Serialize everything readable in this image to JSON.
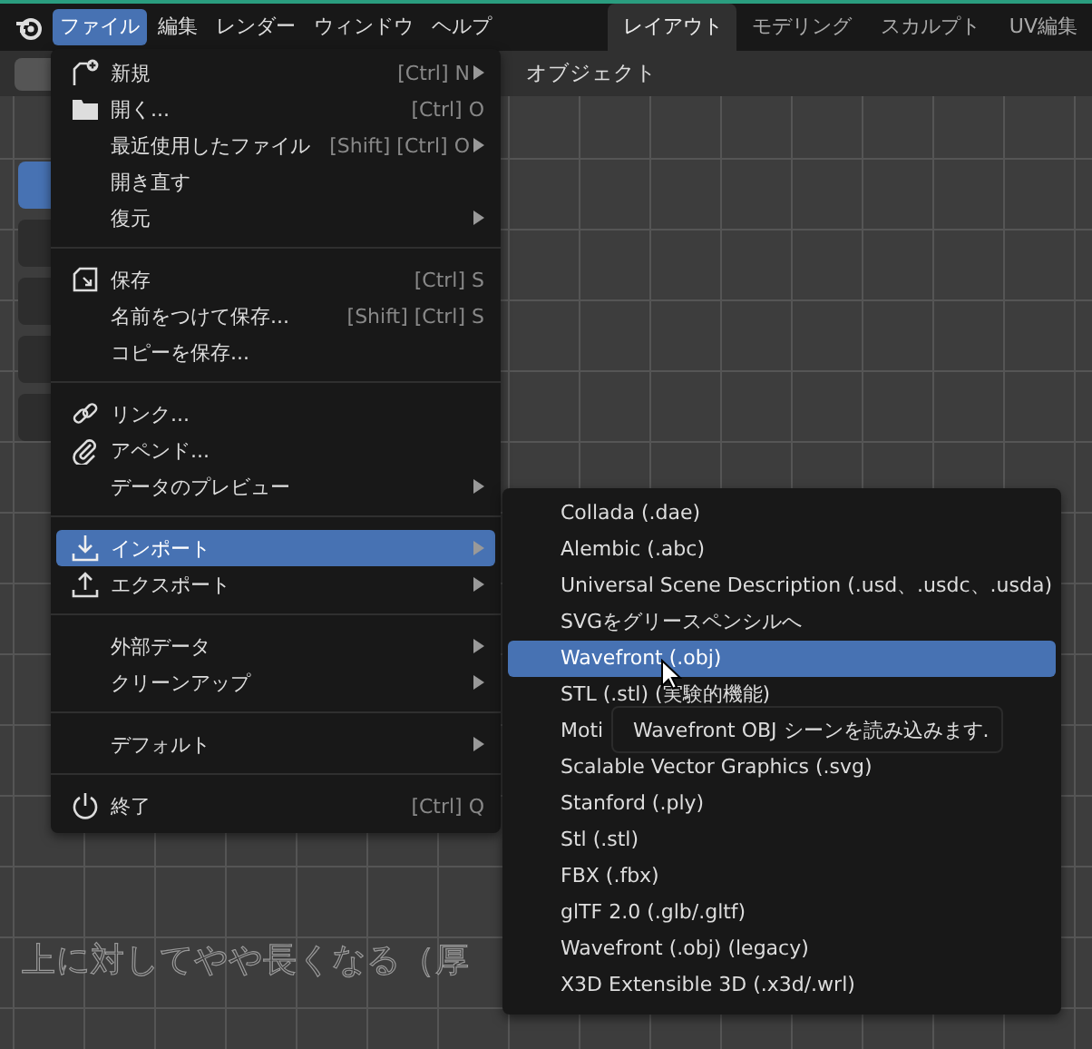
{
  "topbar": {
    "menus": [
      {
        "label": "ファイル",
        "selected": true
      },
      {
        "label": "編集",
        "selected": false
      },
      {
        "label": "レンダー",
        "selected": false
      },
      {
        "label": "ウィンドウ",
        "selected": false
      },
      {
        "label": "ヘルプ",
        "selected": false
      }
    ],
    "workspaces": [
      {
        "label": "レイアウト",
        "selected": true
      },
      {
        "label": "モデリング",
        "selected": false
      },
      {
        "label": "スカルプト",
        "selected": false
      },
      {
        "label": "UV編集",
        "selected": false
      }
    ]
  },
  "viewport": {
    "header_label": "オブジェクト",
    "background_text": "上に対してやや長くなる（厚"
  },
  "file_menu": {
    "groups": [
      [
        {
          "kind": "new",
          "label": "新規",
          "shortcut": "[Ctrl] N",
          "submenu": true,
          "selected": false
        },
        {
          "kind": "open",
          "label": "開く...",
          "shortcut": "[Ctrl] O",
          "submenu": false,
          "selected": false
        },
        {
          "label": "最近使用したファイル",
          "shortcut": "[Shift] [Ctrl] O",
          "submenu": true,
          "selected": false
        },
        {
          "label": "開き直す",
          "submenu": false,
          "selected": false
        },
        {
          "label": "復元",
          "submenu": true,
          "selected": false
        }
      ],
      [
        {
          "kind": "save",
          "label": "保存",
          "shortcut": "[Ctrl] S",
          "submenu": false,
          "selected": false
        },
        {
          "label": "名前をつけて保存...",
          "shortcut": "[Shift] [Ctrl] S",
          "submenu": false,
          "selected": false
        },
        {
          "label": "コピーを保存...",
          "submenu": false,
          "selected": false
        }
      ],
      [
        {
          "kind": "link",
          "label": "リンク...",
          "submenu": false,
          "selected": false
        },
        {
          "kind": "append",
          "label": "アペンド...",
          "submenu": false,
          "selected": false
        },
        {
          "label": "データのプレビュー",
          "submenu": true,
          "selected": false
        }
      ],
      [
        {
          "kind": "import",
          "label": "インポート",
          "submenu": true,
          "selected": true
        },
        {
          "kind": "export",
          "label": "エクスポート",
          "submenu": true,
          "selected": false
        }
      ],
      [
        {
          "label": "外部データ",
          "submenu": true,
          "selected": false
        },
        {
          "label": "クリーンアップ",
          "submenu": true,
          "selected": false
        }
      ],
      [
        {
          "label": "デフォルト",
          "submenu": true,
          "selected": false
        }
      ],
      [
        {
          "kind": "quit",
          "label": "終了",
          "shortcut": "[Ctrl] Q",
          "submenu": false,
          "selected": false
        }
      ]
    ]
  },
  "import_menu": {
    "items": [
      {
        "label": "Collada (.dae)",
        "selected": false
      },
      {
        "label": "Alembic (.abc)",
        "selected": false
      },
      {
        "label": "Universal Scene Description (.usd、.usdc、.usda)",
        "selected": false
      },
      {
        "label": "SVGをグリースペンシルへ",
        "selected": false
      },
      {
        "label": "Wavefront (.obj)",
        "selected": true
      },
      {
        "label": "STL (.stl) (実験的機能)",
        "selected": false
      },
      {
        "label": "Moti",
        "selected": false
      },
      {
        "label": "Scalable Vector Graphics (.svg)",
        "selected": false
      },
      {
        "label": "Stanford (.ply)",
        "selected": false
      },
      {
        "label": "Stl (.stl)",
        "selected": false
      },
      {
        "label": "FBX (.fbx)",
        "selected": false
      },
      {
        "label": "glTF 2.0 (.glb/.gltf)",
        "selected": false
      },
      {
        "label": "Wavefront (.obj) (legacy)",
        "selected": false
      },
      {
        "label": "X3D Extensible 3D (.x3d/.wrl)",
        "selected": false
      }
    ]
  },
  "tooltip": "Wavefront OBJ シーンを読み込みます."
}
